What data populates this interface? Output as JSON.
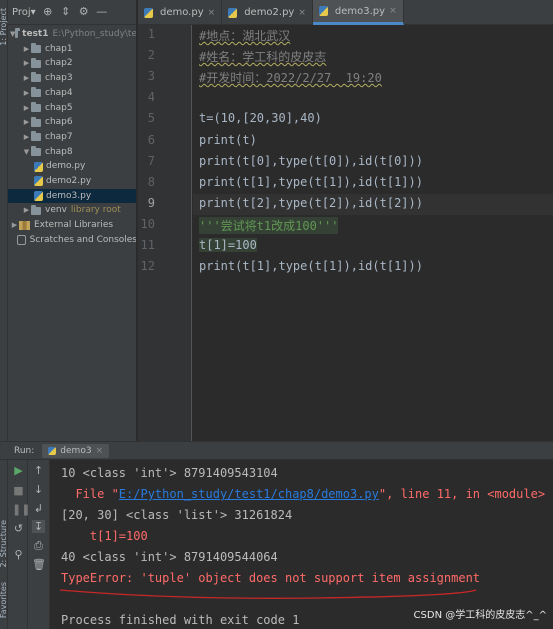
{
  "sidebar_labels": [
    "1: Project",
    "2: Structure",
    "Favorites"
  ],
  "project_panel": {
    "title": "Proj",
    "tree": [
      {
        "label": "test1",
        "extra": "E:\\Python_study\\te",
        "kind": "folder",
        "expanded": true,
        "bold": true
      },
      {
        "label": "chap1",
        "kind": "folder"
      },
      {
        "label": "chap2",
        "kind": "folder"
      },
      {
        "label": "chap3",
        "kind": "folder"
      },
      {
        "label": "chap4",
        "kind": "folder"
      },
      {
        "label": "chap5",
        "kind": "folder"
      },
      {
        "label": "chap6",
        "kind": "folder"
      },
      {
        "label": "chap7",
        "kind": "folder"
      },
      {
        "label": "chap8",
        "kind": "folder",
        "expanded": true
      },
      {
        "label": "demo.py",
        "kind": "file"
      },
      {
        "label": "demo2.py",
        "kind": "file"
      },
      {
        "label": "demo3.py",
        "kind": "file",
        "selected": true
      },
      {
        "label": "venv",
        "extra": "library root",
        "kind": "folder"
      },
      {
        "label": "External Libraries",
        "kind": "lib"
      },
      {
        "label": "Scratches and Consoles",
        "kind": "scratch"
      }
    ]
  },
  "editor": {
    "tabs": [
      {
        "label": "demo.py",
        "active": false
      },
      {
        "label": "demo2.py",
        "active": false
      },
      {
        "label": "demo3.py",
        "active": true
      }
    ],
    "current_line": 9,
    "lines": [
      {
        "n": "1",
        "text": "#地点：湖北武汉",
        "cls": "cmt"
      },
      {
        "n": "2",
        "text": "#姓名：学工科的皮皮志",
        "cls": "cmt"
      },
      {
        "n": "3",
        "text": "#开发时间：2022/2/27  19:20",
        "cls": "cmt"
      },
      {
        "n": "4",
        "text": "",
        "cls": "code-py"
      },
      {
        "n": "5",
        "text": "t=(10,[20,30],40)",
        "cls": "code-py"
      },
      {
        "n": "6",
        "text": "print(t)",
        "cls": "code-py"
      },
      {
        "n": "7",
        "text": "print(t[0],type(t[0]),id(t[0]))",
        "cls": "code-py"
      },
      {
        "n": "8",
        "text": "print(t[1],type(t[1]),id(t[1]))",
        "cls": "code-py"
      },
      {
        "n": "9",
        "text": "print(t[2],type(t[2]),id(t[2]))",
        "cls": "code-py"
      },
      {
        "n": "10",
        "text": "'''尝试将t1改成100'''",
        "cls": "doc"
      },
      {
        "n": "11",
        "text": "t[1]=100",
        "cls": "code-py"
      },
      {
        "n": "12",
        "text": "print(t[1],type(t[1]),id(t[1]))",
        "cls": "code-py"
      }
    ]
  },
  "run_panel": {
    "label": "Run:",
    "tab": "demo3",
    "output": [
      {
        "text": "10 <class 'int'> 8791409543104",
        "cls": ""
      },
      {
        "pre": "  File \"",
        "link": "E:/Python_study/test1/chap8/demo3.py",
        "post": "\", line 11, in <module>",
        "cls": "err"
      },
      {
        "text": "[20, 30] <class 'list'> 31261824",
        "cls": ""
      },
      {
        "text": "    t[1]=100",
        "cls": "err"
      },
      {
        "text": "40 <class 'int'> 8791409544064",
        "cls": ""
      },
      {
        "text": "TypeError: 'tuple' object does not support item assignment",
        "cls": "err"
      },
      {
        "text": "",
        "cls": ""
      },
      {
        "text": "Process finished with exit code 1",
        "cls": ""
      }
    ]
  },
  "watermark": "CSDN @学工科的皮皮志^_^",
  "colors": {
    "accent": "#4a88c7",
    "error": "#ff6b68",
    "annotation_line": "#c62828"
  }
}
